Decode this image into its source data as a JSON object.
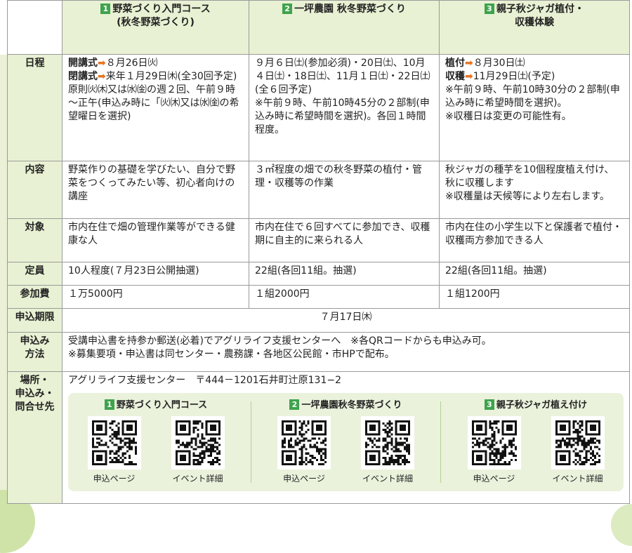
{
  "courses": [
    {
      "num": "1",
      "title_line1": "野菜づくり入門コース",
      "title_line2": "(秋冬野菜づくり)"
    },
    {
      "num": "2",
      "title_line1": "一坪農園 秋冬野菜づくり"
    },
    {
      "num": "3",
      "title_line1": "親子秋ジャガ植付・",
      "title_line2": "収穫体験"
    }
  ],
  "rows": {
    "schedule": {
      "label": "日程",
      "c1": {
        "open_label": "開講式",
        "open_date": "８月26日㈫",
        "close_label": "閉講式",
        "close_date": "来年１月29日㈭(全30回予定)",
        "note": "原則㈫㈭又は㈬㈮の週２回、午前９時～正午(申込み時に「㈫㈭又は㈬㈮の希望曜日を選択)"
      },
      "c2": {
        "text": "９月６日㈯(参加必須)・20日㈯、10月４日㈯・18日㈯、11月１日㈯・22日㈯(全６回予定)",
        "note": "※午前９時、午前10時45分の２部制(申込み時に希望時間を選択)。各回１時間程度。"
      },
      "c3": {
        "plant_label": "植付",
        "plant_date": "８月30日㈯",
        "harvest_label": "収穫",
        "harvest_date": "11月29日㈯(予定)",
        "note1": "※午前９時、午前10時30分の２部制(申込み時に希望時間を選択)。",
        "note2": "※収穫日は変更の可能性有。"
      }
    },
    "content": {
      "label": "内容",
      "c1": "野菜作りの基礎を学びたい、自分で野菜をつくってみたい等、初心者向けの講座",
      "c2": "３㎡程度の畑での秋冬野菜の植付・管理・収穫等の作業",
      "c3": "秋ジャガの種芋を10個程度植え付け、秋に収穫します",
      "c3_note": "※収穫量は天候等により左右します。"
    },
    "target": {
      "label": "対象",
      "c1": "市内在住で畑の管理作業等ができる健康な人",
      "c2": "市内在住で６回すべてに参加でき、収穫期に自主的に来られる人",
      "c3": "市内在住の小学生以下と保護者で植付・収穫両方参加できる人"
    },
    "capacity": {
      "label": "定員",
      "c1": "10人程度(７月23日公開抽選)",
      "c2": "22組(各回11組。抽選)",
      "c3": "22組(各回11組。抽選)"
    },
    "fee": {
      "label": "参加費",
      "c1": "１万5000円",
      "c2": "１組2000円",
      "c3": "１組1200円"
    },
    "deadline": {
      "label": "申込期限",
      "value": "７月17日㈭"
    },
    "method": {
      "label_line1": "申込み",
      "label_line2": "方法",
      "line1": "受講申込書を持参か郵送(必着)でアグリライフ支援センターへ　※各QRコードからも申込み可。",
      "line2": "※募集要項・申込書は同センター・農務課・各地区公民館・市HPで配布。"
    },
    "place": {
      "label_line1": "場所・",
      "label_line2": "申込み・",
      "label_line3": "問合せ先",
      "address": "アグリライフ支援センター　〒444－1201石井町辻原131−2"
    }
  },
  "qr_groups": [
    {
      "num": "1",
      "title": "野菜づくり入門コース",
      "items": [
        "申込ページ",
        "イベント詳細"
      ]
    },
    {
      "num": "2",
      "title": "一坪農園秋冬野菜づくり",
      "items": [
        "申込ページ",
        "イベント詳細"
      ]
    },
    {
      "num": "3",
      "title": "親子秋ジャガ植え付け",
      "items": [
        "申込ページ",
        "イベント詳細"
      ]
    }
  ],
  "colors": {
    "header_green": "#e8f1d3",
    "badge_green": "#3fa34d",
    "arrow_orange": "#e87522",
    "qr_panel": "#eaf2dc"
  }
}
